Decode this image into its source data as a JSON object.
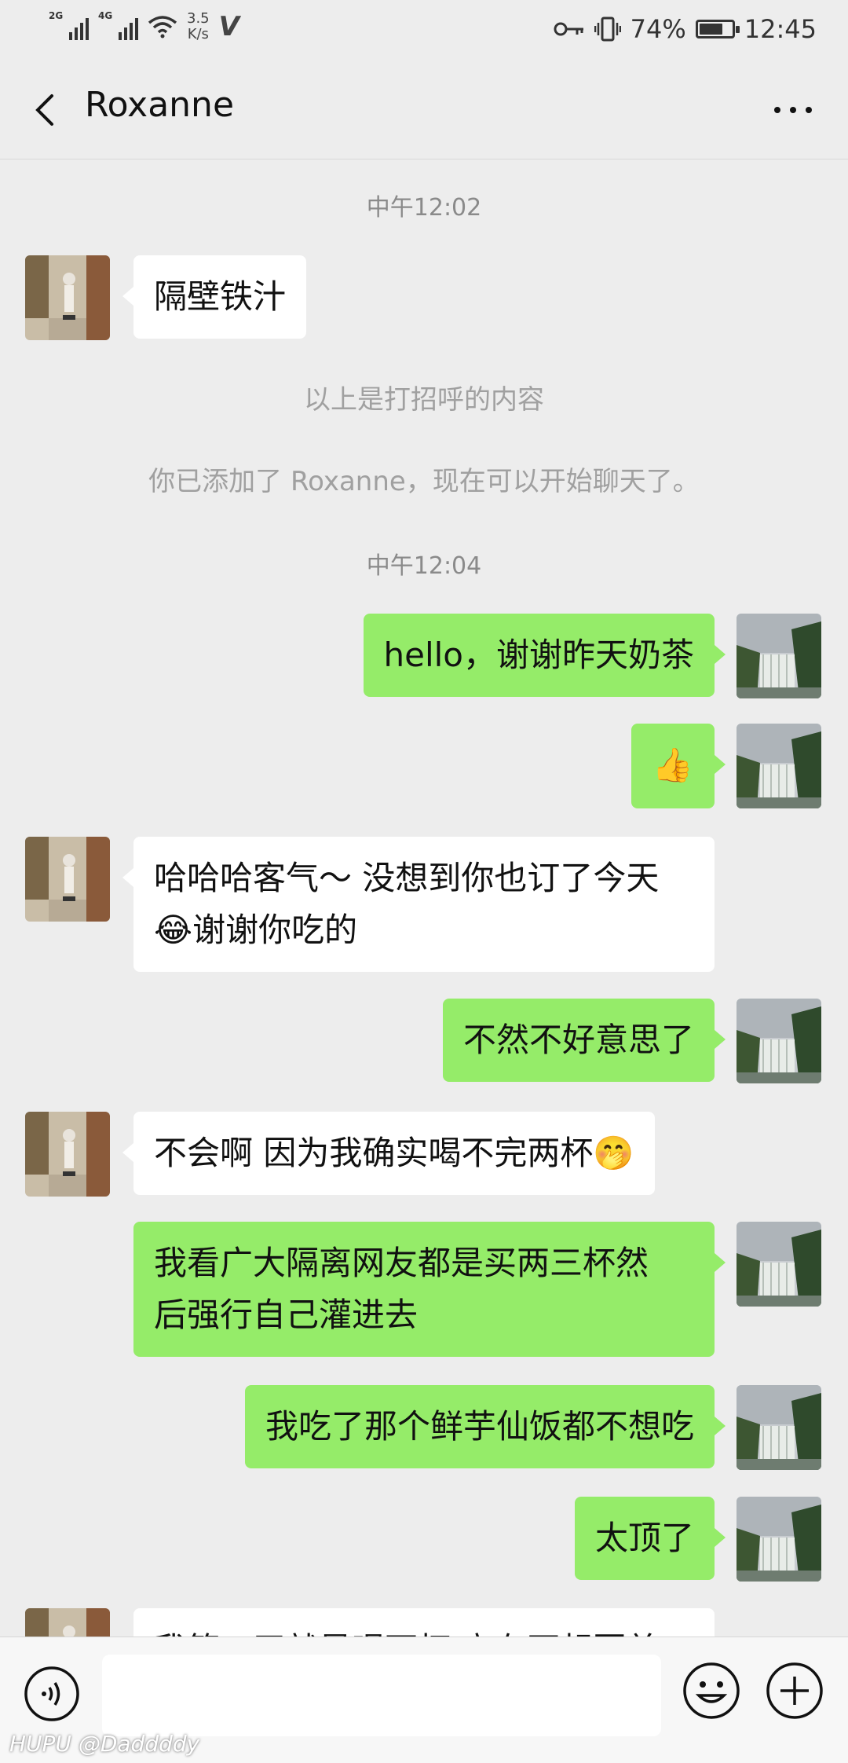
{
  "status_bar": {
    "net1": "2G",
    "net2": "4G",
    "speed_value": "3.5",
    "speed_unit": "K/s",
    "battery_pct": "74%",
    "battery_level": 0.74,
    "time": "12:45"
  },
  "header": {
    "title": "Roxanne"
  },
  "chat": {
    "ts1": "中午12:02",
    "msg1": "隔壁铁汁",
    "sys1": "以上是打招呼的内容",
    "sys2": "你已添加了 Roxanne，现在可以开始聊天了。",
    "ts2": "中午12:04",
    "msg2": "hello，谢谢昨天奶茶",
    "msg3_emoji": "👍",
    "msg4_line1": "哈哈哈客气～ 没想到你也订了今天",
    "msg4_emoji": "😂",
    "msg4_line2": "谢谢你吃的",
    "msg5": "不然不好意思了",
    "msg6": "不会啊 因为我确实喝不完两杯",
    "msg6_emoji": "🤭",
    "msg7_line1": "我看广大隔离网友都是买两三杯然",
    "msg7_line2": "后强行自己灌进去",
    "msg8": "我吃了那个鲜芋仙饭都不想吃",
    "msg9": "太顶了",
    "msg10_partial": "我第一天就是喝两杯 立有不想要差"
  },
  "watermark": "HUPU @Daddddy",
  "colors": {
    "bg": "#ededed",
    "out_bubble": "#95ec69",
    "in_bubble": "#ffffff"
  }
}
